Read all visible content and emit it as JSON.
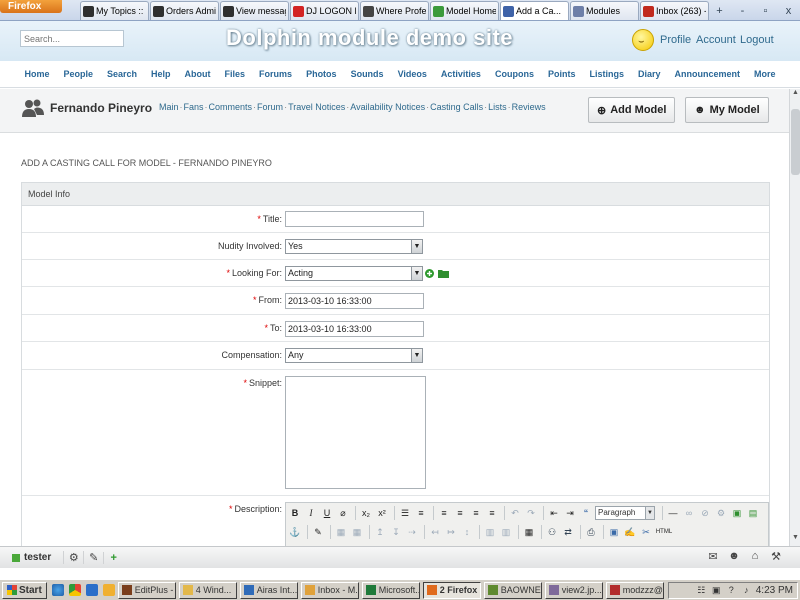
{
  "browser": {
    "menu_button": "Firefox",
    "tabs": [
      {
        "label": "My Topics :: ...",
        "color": "#2f2f2f"
      },
      {
        "label": "Orders Admi...",
        "color": "#2f2f2f"
      },
      {
        "label": "View message",
        "color": "#2f2f2f"
      },
      {
        "label": "DJ LOGON D...",
        "color": "#d32323"
      },
      {
        "label": "Where Profe...",
        "color": "#444444"
      },
      {
        "label": "Model Home",
        "color": "#3b9a3b"
      },
      {
        "label": "Add a Ca...",
        "color": "#3f63a8"
      },
      {
        "label": "Modules",
        "color": "#6e7fa8"
      },
      {
        "label": "Inbox (263) - ...",
        "color": "#c1291d"
      }
    ],
    "window_controls": [
      "+",
      "-",
      "▫",
      "x"
    ]
  },
  "site": {
    "search_placeholder": "Search...",
    "title": "Dolphin module demo site",
    "links": {
      "profile": "Profile",
      "account": "Account",
      "logout": "Logout"
    }
  },
  "main_nav": [
    "Home",
    "People",
    "Search",
    "Help",
    "About",
    "Files",
    "Forums",
    "Photos",
    "Sounds",
    "Videos",
    "Activities",
    "Coupons",
    "Points",
    "Listings",
    "Diary",
    "Announcement",
    "More"
  ],
  "module_bar": {
    "user": "Fernando Pineyro",
    "links": [
      "Main",
      "Fans",
      "Comments",
      "Forum",
      "Travel Notices",
      "Availability Notices",
      "Casting Calls",
      "Lists",
      "Reviews"
    ],
    "add_model": "Add Model",
    "my_model": "My Model"
  },
  "page": {
    "heading": "ADD A CASTING CALL FOR MODEL - FERNANDO PINEYRO",
    "section": "Model Info"
  },
  "form": {
    "title_label": "Title:",
    "title_value": "",
    "nudity_label": "Nudity Involved:",
    "nudity_value": "Yes",
    "looking_label": "Looking For:",
    "looking_value": "Acting",
    "from_label": "From:",
    "from_value": "2013-03-10 16:33:00",
    "to_label": "To:",
    "to_value": "2013-03-10 16:33:00",
    "compensation_label": "Compensation:",
    "compensation_value": "Any",
    "snippet_label": "Snippet:",
    "description_label": "Description:",
    "paragraph_format": "Paragraph",
    "html_button": "HTML"
  },
  "site_toolbar": {
    "user": "tester"
  },
  "taskbar": {
    "start": "Start",
    "buttons": [
      {
        "label": "EditPlus - ...",
        "color": "#7a3e1c"
      },
      {
        "label": "4 Wind...",
        "color": "#e3b84a"
      },
      {
        "label": "Airas Int...",
        "color": "#2f6bb8"
      },
      {
        "label": "Inbox - M...",
        "color": "#e0a23b"
      },
      {
        "label": "Microsoft...",
        "color": "#1f7a3a"
      },
      {
        "label": "2 Firefox",
        "color": "#e06a1c"
      },
      {
        "label": "BAOWNE...",
        "color": "#5f8a2f"
      },
      {
        "label": "view2.jp...",
        "color": "#7f6a9a"
      },
      {
        "label": "modzzz@...",
        "color": "#b32d2d"
      }
    ],
    "clock": "4:23 PM"
  }
}
